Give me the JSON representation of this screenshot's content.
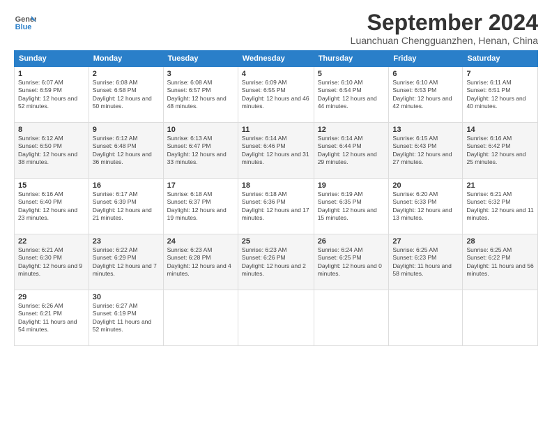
{
  "header": {
    "logo_line1": "General",
    "logo_line2": "Blue",
    "month": "September 2024",
    "location": "Luanchuan Chengguanzhen, Henan, China"
  },
  "weekdays": [
    "Sunday",
    "Monday",
    "Tuesday",
    "Wednesday",
    "Thursday",
    "Friday",
    "Saturday"
  ],
  "weeks": [
    [
      {
        "day": "1",
        "sunrise": "Sunrise: 6:07 AM",
        "sunset": "Sunset: 6:59 PM",
        "daylight": "Daylight: 12 hours and 52 minutes."
      },
      {
        "day": "2",
        "sunrise": "Sunrise: 6:08 AM",
        "sunset": "Sunset: 6:58 PM",
        "daylight": "Daylight: 12 hours and 50 minutes."
      },
      {
        "day": "3",
        "sunrise": "Sunrise: 6:08 AM",
        "sunset": "Sunset: 6:57 PM",
        "daylight": "Daylight: 12 hours and 48 minutes."
      },
      {
        "day": "4",
        "sunrise": "Sunrise: 6:09 AM",
        "sunset": "Sunset: 6:55 PM",
        "daylight": "Daylight: 12 hours and 46 minutes."
      },
      {
        "day": "5",
        "sunrise": "Sunrise: 6:10 AM",
        "sunset": "Sunset: 6:54 PM",
        "daylight": "Daylight: 12 hours and 44 minutes."
      },
      {
        "day": "6",
        "sunrise": "Sunrise: 6:10 AM",
        "sunset": "Sunset: 6:53 PM",
        "daylight": "Daylight: 12 hours and 42 minutes."
      },
      {
        "day": "7",
        "sunrise": "Sunrise: 6:11 AM",
        "sunset": "Sunset: 6:51 PM",
        "daylight": "Daylight: 12 hours and 40 minutes."
      }
    ],
    [
      {
        "day": "8",
        "sunrise": "Sunrise: 6:12 AM",
        "sunset": "Sunset: 6:50 PM",
        "daylight": "Daylight: 12 hours and 38 minutes."
      },
      {
        "day": "9",
        "sunrise": "Sunrise: 6:12 AM",
        "sunset": "Sunset: 6:48 PM",
        "daylight": "Daylight: 12 hours and 36 minutes."
      },
      {
        "day": "10",
        "sunrise": "Sunrise: 6:13 AM",
        "sunset": "Sunset: 6:47 PM",
        "daylight": "Daylight: 12 hours and 33 minutes."
      },
      {
        "day": "11",
        "sunrise": "Sunrise: 6:14 AM",
        "sunset": "Sunset: 6:46 PM",
        "daylight": "Daylight: 12 hours and 31 minutes."
      },
      {
        "day": "12",
        "sunrise": "Sunrise: 6:14 AM",
        "sunset": "Sunset: 6:44 PM",
        "daylight": "Daylight: 12 hours and 29 minutes."
      },
      {
        "day": "13",
        "sunrise": "Sunrise: 6:15 AM",
        "sunset": "Sunset: 6:43 PM",
        "daylight": "Daylight: 12 hours and 27 minutes."
      },
      {
        "day": "14",
        "sunrise": "Sunrise: 6:16 AM",
        "sunset": "Sunset: 6:42 PM",
        "daylight": "Daylight: 12 hours and 25 minutes."
      }
    ],
    [
      {
        "day": "15",
        "sunrise": "Sunrise: 6:16 AM",
        "sunset": "Sunset: 6:40 PM",
        "daylight": "Daylight: 12 hours and 23 minutes."
      },
      {
        "day": "16",
        "sunrise": "Sunrise: 6:17 AM",
        "sunset": "Sunset: 6:39 PM",
        "daylight": "Daylight: 12 hours and 21 minutes."
      },
      {
        "day": "17",
        "sunrise": "Sunrise: 6:18 AM",
        "sunset": "Sunset: 6:37 PM",
        "daylight": "Daylight: 12 hours and 19 minutes."
      },
      {
        "day": "18",
        "sunrise": "Sunrise: 6:18 AM",
        "sunset": "Sunset: 6:36 PM",
        "daylight": "Daylight: 12 hours and 17 minutes."
      },
      {
        "day": "19",
        "sunrise": "Sunrise: 6:19 AM",
        "sunset": "Sunset: 6:35 PM",
        "daylight": "Daylight: 12 hours and 15 minutes."
      },
      {
        "day": "20",
        "sunrise": "Sunrise: 6:20 AM",
        "sunset": "Sunset: 6:33 PM",
        "daylight": "Daylight: 12 hours and 13 minutes."
      },
      {
        "day": "21",
        "sunrise": "Sunrise: 6:21 AM",
        "sunset": "Sunset: 6:32 PM",
        "daylight": "Daylight: 12 hours and 11 minutes."
      }
    ],
    [
      {
        "day": "22",
        "sunrise": "Sunrise: 6:21 AM",
        "sunset": "Sunset: 6:30 PM",
        "daylight": "Daylight: 12 hours and 9 minutes."
      },
      {
        "day": "23",
        "sunrise": "Sunrise: 6:22 AM",
        "sunset": "Sunset: 6:29 PM",
        "daylight": "Daylight: 12 hours and 7 minutes."
      },
      {
        "day": "24",
        "sunrise": "Sunrise: 6:23 AM",
        "sunset": "Sunset: 6:28 PM",
        "daylight": "Daylight: 12 hours and 4 minutes."
      },
      {
        "day": "25",
        "sunrise": "Sunrise: 6:23 AM",
        "sunset": "Sunset: 6:26 PM",
        "daylight": "Daylight: 12 hours and 2 minutes."
      },
      {
        "day": "26",
        "sunrise": "Sunrise: 6:24 AM",
        "sunset": "Sunset: 6:25 PM",
        "daylight": "Daylight: 12 hours and 0 minutes."
      },
      {
        "day": "27",
        "sunrise": "Sunrise: 6:25 AM",
        "sunset": "Sunset: 6:23 PM",
        "daylight": "Daylight: 11 hours and 58 minutes."
      },
      {
        "day": "28",
        "sunrise": "Sunrise: 6:25 AM",
        "sunset": "Sunset: 6:22 PM",
        "daylight": "Daylight: 11 hours and 56 minutes."
      }
    ],
    [
      {
        "day": "29",
        "sunrise": "Sunrise: 6:26 AM",
        "sunset": "Sunset: 6:21 PM",
        "daylight": "Daylight: 11 hours and 54 minutes."
      },
      {
        "day": "30",
        "sunrise": "Sunrise: 6:27 AM",
        "sunset": "Sunset: 6:19 PM",
        "daylight": "Daylight: 11 hours and 52 minutes."
      },
      null,
      null,
      null,
      null,
      null
    ]
  ]
}
